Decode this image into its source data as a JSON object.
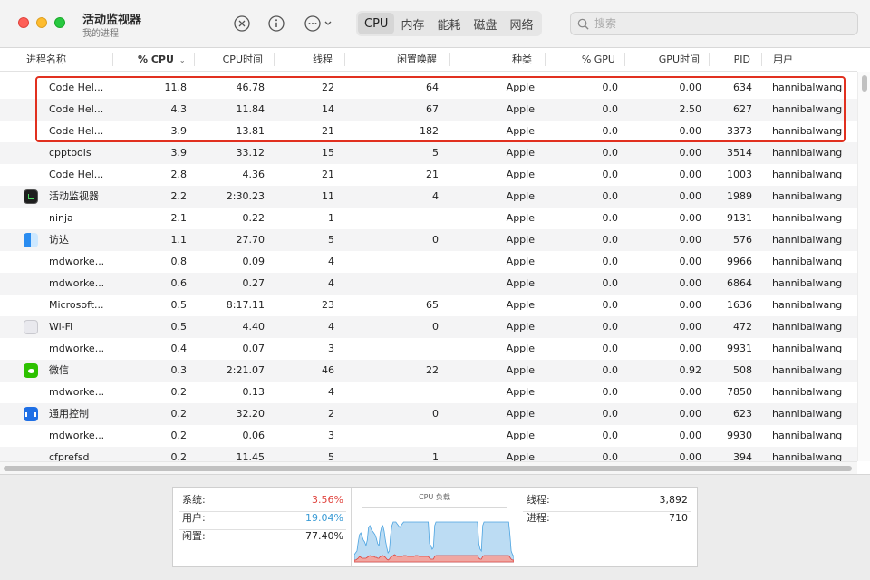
{
  "window": {
    "title": "活动监视器",
    "subtitle": "我的进程"
  },
  "toolbar": {
    "icons": [
      "stop-process-icon",
      "info-icon",
      "more-actions-icon"
    ],
    "tabs": [
      {
        "label": "CPU",
        "active": true
      },
      {
        "label": "内存",
        "active": false
      },
      {
        "label": "能耗",
        "active": false
      },
      {
        "label": "磁盘",
        "active": false
      },
      {
        "label": "网络",
        "active": false
      }
    ],
    "search_placeholder": "搜索"
  },
  "table": {
    "columns": [
      "进程名称",
      "% CPU",
      "CPU时间",
      "线程",
      "闲置唤醒",
      "种类",
      "% GPU",
      "GPU时间",
      "PID",
      "用户"
    ],
    "sorted_column": "% CPU",
    "sort_direction": "descending",
    "rows": [
      {
        "name": "Code Hel...",
        "icon": "",
        "cpu": "11.8",
        "cpu_time": "46.78",
        "threads": "22",
        "idle_wakeups": "64",
        "kind": "Apple",
        "gpu": "0.0",
        "gpu_time": "0.00",
        "pid": "634",
        "user": "hannibalwang"
      },
      {
        "name": "Code Hel...",
        "icon": "",
        "cpu": "4.3",
        "cpu_time": "11.84",
        "threads": "14",
        "idle_wakeups": "67",
        "kind": "Apple",
        "gpu": "0.0",
        "gpu_time": "2.50",
        "pid": "627",
        "user": "hannibalwang"
      },
      {
        "name": "Code Hel...",
        "icon": "",
        "cpu": "3.9",
        "cpu_time": "13.81",
        "threads": "21",
        "idle_wakeups": "182",
        "kind": "Apple",
        "gpu": "0.0",
        "gpu_time": "0.00",
        "pid": "3373",
        "user": "hannibalwang"
      },
      {
        "name": "cpptools",
        "icon": "",
        "cpu": "3.9",
        "cpu_time": "33.12",
        "threads": "15",
        "idle_wakeups": "5",
        "kind": "Apple",
        "gpu": "0.0",
        "gpu_time": "0.00",
        "pid": "3514",
        "user": "hannibalwang"
      },
      {
        "name": "Code Hel...",
        "icon": "",
        "cpu": "2.8",
        "cpu_time": "4.36",
        "threads": "21",
        "idle_wakeups": "21",
        "kind": "Apple",
        "gpu": "0.0",
        "gpu_time": "0.00",
        "pid": "1003",
        "user": "hannibalwang"
      },
      {
        "name": "活动监视器",
        "icon": "activity-monitor-icon",
        "cpu": "2.2",
        "cpu_time": "2:30.23",
        "threads": "11",
        "idle_wakeups": "4",
        "kind": "Apple",
        "gpu": "0.0",
        "gpu_time": "0.00",
        "pid": "1989",
        "user": "hannibalwang"
      },
      {
        "name": "ninja",
        "icon": "",
        "cpu": "2.1",
        "cpu_time": "0.22",
        "threads": "1",
        "idle_wakeups": "",
        "kind": "Apple",
        "gpu": "0.0",
        "gpu_time": "0.00",
        "pid": "9131",
        "user": "hannibalwang"
      },
      {
        "name": "访达",
        "icon": "finder-icon",
        "cpu": "1.1",
        "cpu_time": "27.70",
        "threads": "5",
        "idle_wakeups": "0",
        "kind": "Apple",
        "gpu": "0.0",
        "gpu_time": "0.00",
        "pid": "576",
        "user": "hannibalwang"
      },
      {
        "name": "mdworke...",
        "icon": "",
        "cpu": "0.8",
        "cpu_time": "0.09",
        "threads": "4",
        "idle_wakeups": "",
        "kind": "Apple",
        "gpu": "0.0",
        "gpu_time": "0.00",
        "pid": "9966",
        "user": "hannibalwang"
      },
      {
        "name": "mdworke...",
        "icon": "",
        "cpu": "0.6",
        "cpu_time": "0.27",
        "threads": "4",
        "idle_wakeups": "",
        "kind": "Apple",
        "gpu": "0.0",
        "gpu_time": "0.00",
        "pid": "6864",
        "user": "hannibalwang"
      },
      {
        "name": "Microsoft...",
        "icon": "",
        "cpu": "0.5",
        "cpu_time": "8:17.11",
        "threads": "23",
        "idle_wakeups": "65",
        "kind": "Apple",
        "gpu": "0.0",
        "gpu_time": "0.00",
        "pid": "1636",
        "user": "hannibalwang"
      },
      {
        "name": "Wi-Fi",
        "icon": "wifi-app-icon",
        "cpu": "0.5",
        "cpu_time": "4.40",
        "threads": "4",
        "idle_wakeups": "0",
        "kind": "Apple",
        "gpu": "0.0",
        "gpu_time": "0.00",
        "pid": "472",
        "user": "hannibalwang"
      },
      {
        "name": "mdworke...",
        "icon": "",
        "cpu": "0.4",
        "cpu_time": "0.07",
        "threads": "3",
        "idle_wakeups": "",
        "kind": "Apple",
        "gpu": "0.0",
        "gpu_time": "0.00",
        "pid": "9931",
        "user": "hannibalwang"
      },
      {
        "name": "微信",
        "icon": "wechat-icon",
        "cpu": "0.3",
        "cpu_time": "2:21.07",
        "threads": "46",
        "idle_wakeups": "22",
        "kind": "Apple",
        "gpu": "0.0",
        "gpu_time": "0.92",
        "pid": "508",
        "user": "hannibalwang"
      },
      {
        "name": "mdworke...",
        "icon": "",
        "cpu": "0.2",
        "cpu_time": "0.13",
        "threads": "4",
        "idle_wakeups": "",
        "kind": "Apple",
        "gpu": "0.0",
        "gpu_time": "0.00",
        "pid": "7850",
        "user": "hannibalwang"
      },
      {
        "name": "通用控制",
        "icon": "universal-control-icon",
        "cpu": "0.2",
        "cpu_time": "32.20",
        "threads": "2",
        "idle_wakeups": "0",
        "kind": "Apple",
        "gpu": "0.0",
        "gpu_time": "0.00",
        "pid": "623",
        "user": "hannibalwang"
      },
      {
        "name": "mdworke...",
        "icon": "",
        "cpu": "0.2",
        "cpu_time": "0.06",
        "threads": "3",
        "idle_wakeups": "",
        "kind": "Apple",
        "gpu": "0.0",
        "gpu_time": "0.00",
        "pid": "9930",
        "user": "hannibalwang"
      },
      {
        "name": "cfprefsd",
        "icon": "",
        "cpu": "0.2",
        "cpu_time": "11.45",
        "threads": "5",
        "idle_wakeups": "1",
        "kind": "Apple",
        "gpu": "0.0",
        "gpu_time": "0.00",
        "pid": "394",
        "user": "hannibalwang"
      }
    ]
  },
  "summary": {
    "system_label": "系统:",
    "system_value": "3.56%",
    "user_label": "用户:",
    "user_value": "19.04%",
    "idle_label": "闲置:",
    "idle_value": "77.40%",
    "chart_title": "CPU 负载",
    "threads_label": "线程:",
    "threads_value": "3,892",
    "processes_label": "进程:",
    "processes_value": "710"
  },
  "colors": {
    "system": "#e0443e",
    "user": "#3a9bd5",
    "highlight": "#e1301f"
  },
  "cpu_load": {
    "user_fill": [
      8,
      10,
      12,
      22,
      30,
      32,
      28,
      24,
      22,
      18,
      24,
      38,
      40,
      36,
      34,
      32,
      30,
      26,
      20,
      18,
      32,
      38,
      40,
      34,
      24,
      16,
      10,
      12,
      30,
      40,
      44,
      44,
      44,
      42,
      40,
      38,
      40,
      42,
      44,
      44,
      44,
      44,
      44,
      44,
      44,
      44,
      44,
      44,
      44,
      44,
      44,
      44,
      44,
      44,
      44,
      44,
      44,
      44,
      20,
      18,
      14,
      16,
      40,
      44,
      44,
      44,
      44,
      44,
      44,
      44,
      44,
      44,
      44,
      44,
      44,
      44,
      44,
      44,
      44,
      44,
      44,
      44,
      44,
      44,
      44,
      44,
      44,
      44,
      44,
      44,
      44,
      44,
      44,
      44,
      44,
      44,
      20,
      14,
      12,
      40,
      44,
      44,
      44,
      44,
      44,
      44,
      44,
      44,
      44,
      44,
      44,
      44,
      44,
      44,
      44,
      44,
      44,
      44,
      44,
      44,
      30,
      12,
      8,
      6
    ],
    "system_fill": [
      2,
      2,
      3,
      4,
      6,
      5,
      4,
      4,
      4,
      4,
      5,
      6,
      7,
      6,
      6,
      6,
      5,
      5,
      4,
      4,
      6,
      6,
      7,
      6,
      5,
      3,
      2,
      3,
      5,
      6,
      7,
      8,
      7,
      6,
      6,
      6,
      6,
      6,
      7,
      7,
      7,
      6,
      6,
      6,
      6,
      6,
      6,
      7,
      7,
      7,
      6,
      6,
      6,
      6,
      6,
      6,
      6,
      6,
      4,
      3,
      3,
      3,
      6,
      7,
      7,
      7,
      7,
      7,
      7,
      7,
      7,
      7,
      7,
      7,
      7,
      7,
      7,
      7,
      7,
      7,
      7,
      7,
      7,
      7,
      7,
      7,
      7,
      7,
      7,
      7,
      7,
      7,
      7,
      7,
      7,
      7,
      4,
      3,
      3,
      6,
      7,
      7,
      7,
      7,
      7,
      7,
      7,
      7,
      7,
      7,
      7,
      7,
      7,
      7,
      7,
      7,
      7,
      7,
      7,
      7,
      5,
      3,
      2,
      2
    ]
  }
}
